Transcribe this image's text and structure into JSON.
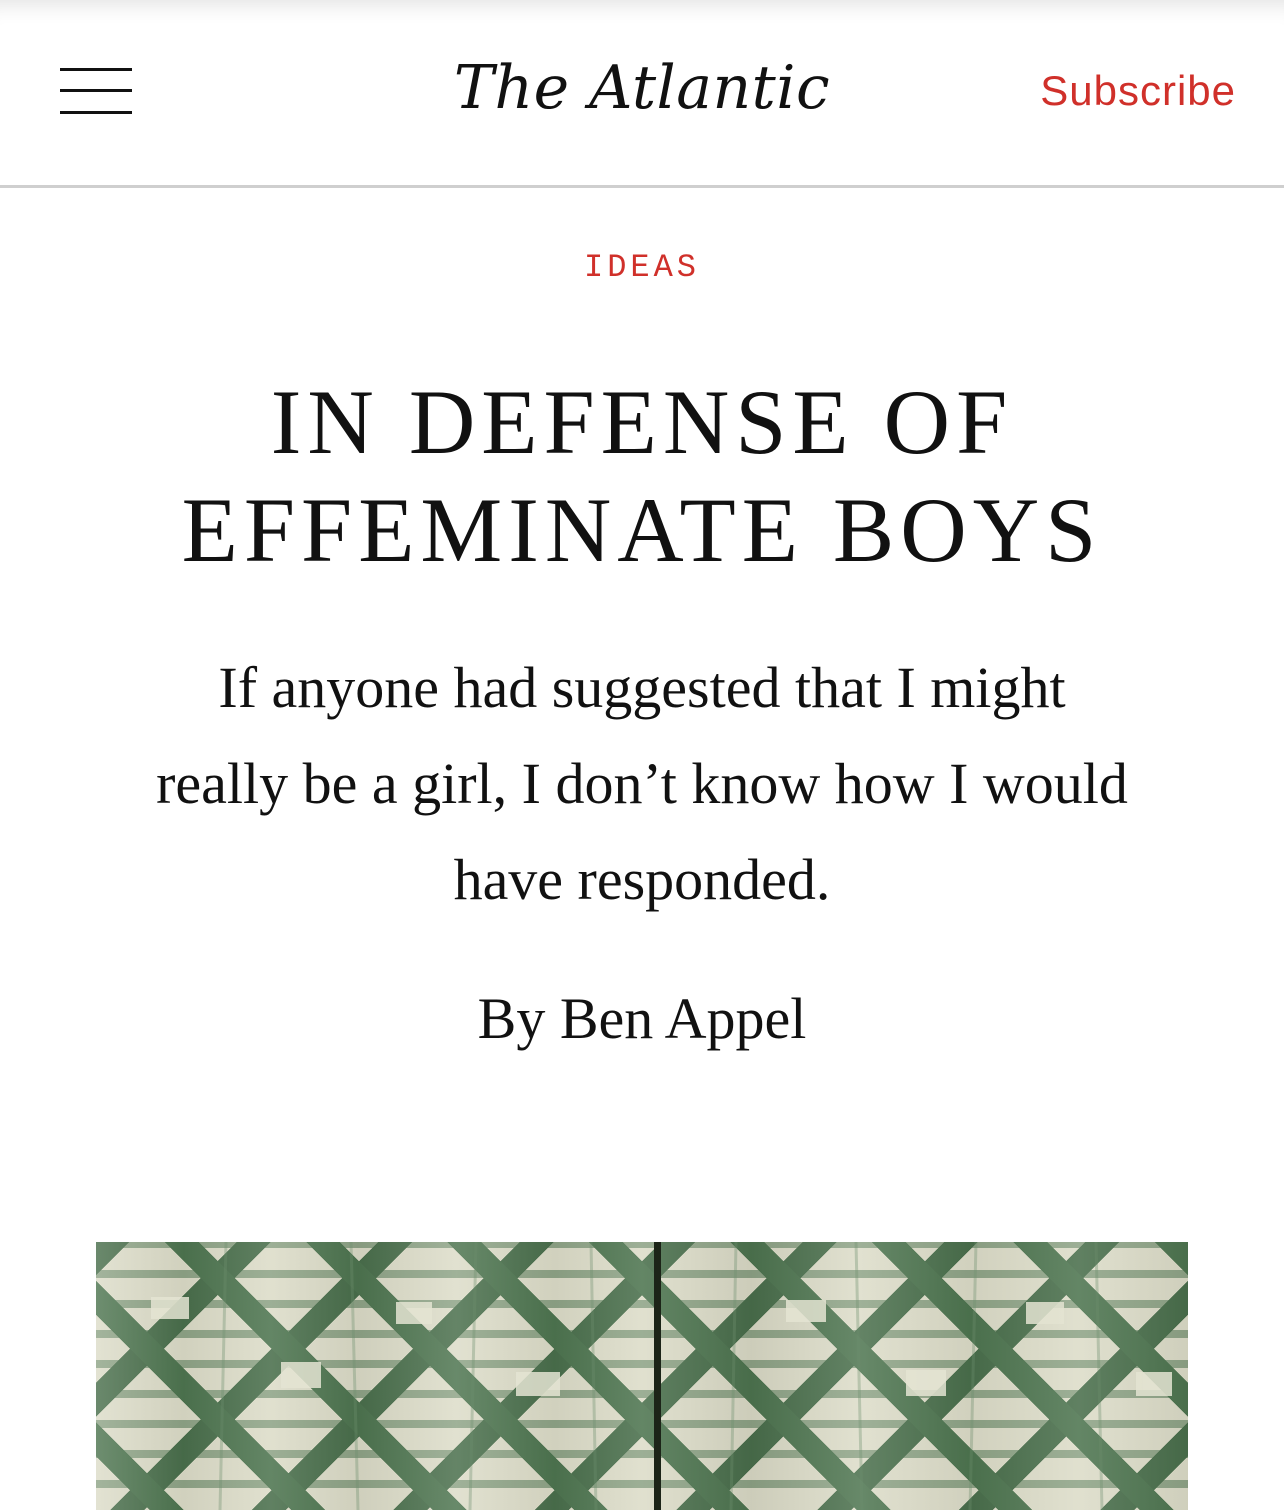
{
  "header": {
    "menu_icon": "hamburger-menu-icon",
    "logo_text": "The Atlantic",
    "subscribe_label": "Subscribe",
    "accent_color": "#d0302a"
  },
  "article": {
    "section": "IDEAS",
    "headline": "IN DEFENSE OF EFFEMINATE BOYS",
    "dek": "If anyone had suggested that I might really be a girl, I don’t know how I would have responded.",
    "byline_prefix": "By",
    "author": "Ben Appel"
  },
  "hero_image": {
    "description_icon": "green-ikat-curtain-photo"
  }
}
